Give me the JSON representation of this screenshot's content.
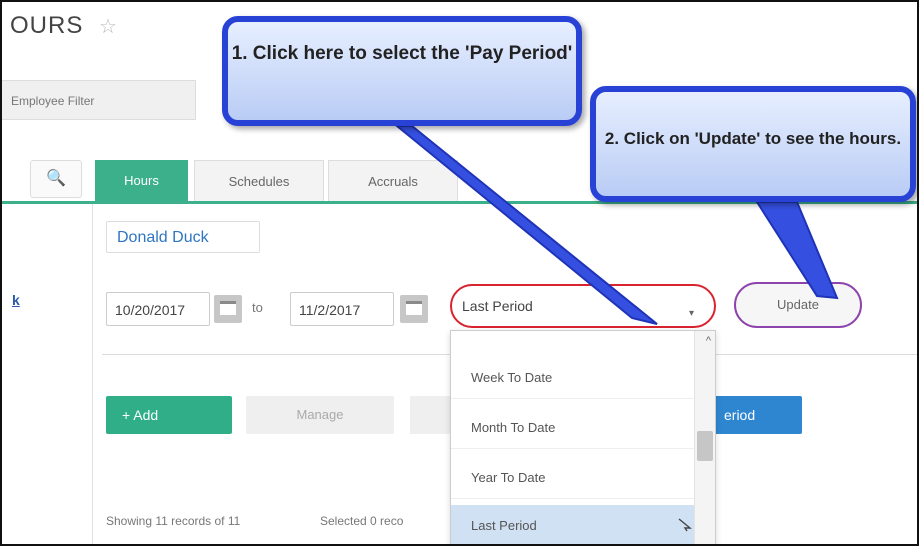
{
  "header": {
    "title": "OURS",
    "star_icon": "star-outline-icon"
  },
  "employee_filter": {
    "label": "Employee Filter"
  },
  "tabs": [
    {
      "label": "Hours",
      "active": true
    },
    {
      "label": "Schedules",
      "active": false
    },
    {
      "label": "Accruals",
      "active": false
    }
  ],
  "sidebar": {
    "link_label": "k"
  },
  "form": {
    "employee_name": "Donald Duck",
    "start_date": "10/20/2017",
    "to_label": "to",
    "end_date": "11/2/2017",
    "pay_period_value": "Last Period",
    "update_label": "Update"
  },
  "toolbar": {
    "add_label": "+  Add",
    "manage_label": "Manage",
    "period_label": "eriod"
  },
  "footer": {
    "showing": "Showing 11 records of 11",
    "selected": "Selected 0 reco"
  },
  "dropdown": {
    "options": [
      "Week To Date",
      "Month To Date",
      "Year To Date",
      "Last Period"
    ],
    "highlighted": "Last Period"
  },
  "callouts": {
    "step1": "1. Click here to select the 'Pay Period'",
    "step2": "2. Click on 'Update' to see the hours."
  },
  "colors": {
    "accent_green": "#3bb08a",
    "period_blue": "#2f86d0",
    "callout_border": "#2942d6",
    "select_highlight": "#d9232f",
    "update_highlight": "#8e44ad"
  }
}
